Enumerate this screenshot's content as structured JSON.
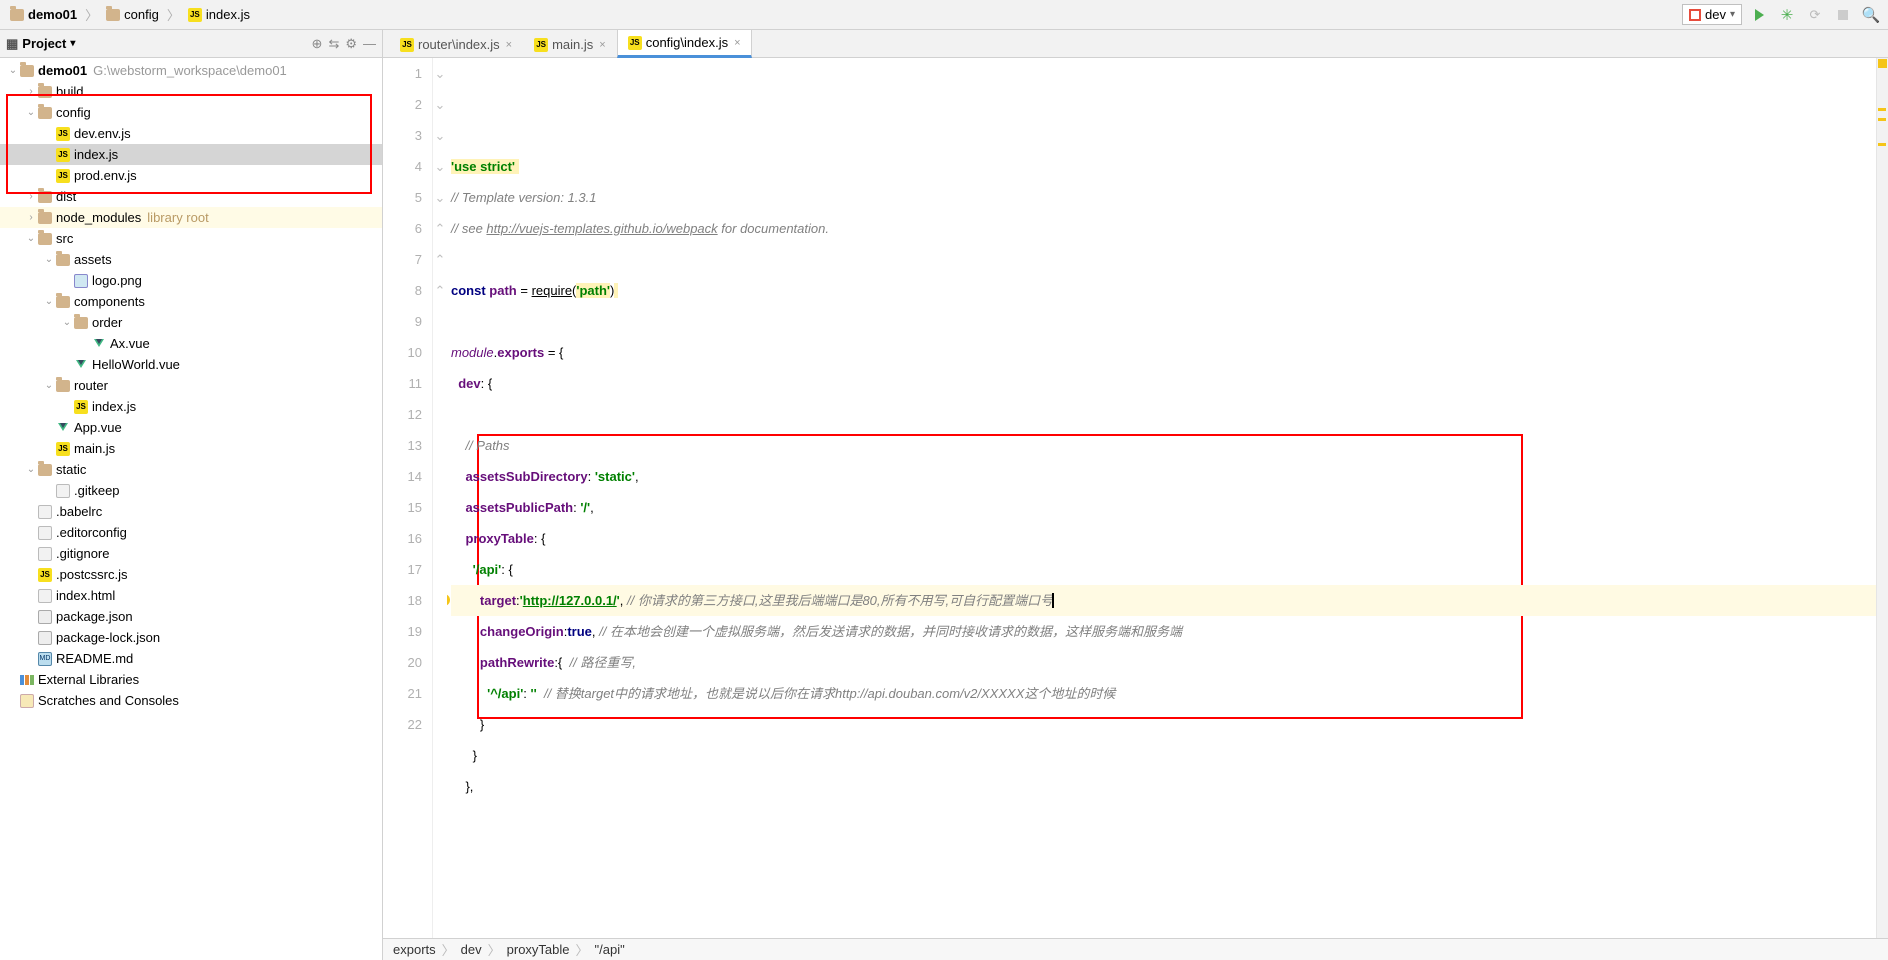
{
  "breadcrumbs": [
    {
      "label": "demo01",
      "icon": "folder",
      "bold": true
    },
    {
      "label": "config",
      "icon": "folder"
    },
    {
      "label": "index.js",
      "icon": "js"
    }
  ],
  "run_config": "dev",
  "project_panel": {
    "title": "Project"
  },
  "tree": [
    {
      "d": 0,
      "tw": "v",
      "ico": "folder",
      "lbl": "demo01",
      "hint": "G:\\webstorm_workspace\\demo01",
      "bold": true
    },
    {
      "d": 1,
      "tw": ">",
      "ico": "folder",
      "lbl": "build"
    },
    {
      "d": 1,
      "tw": "v",
      "ico": "folder",
      "lbl": "config"
    },
    {
      "d": 2,
      "tw": "",
      "ico": "js",
      "lbl": "dev.env.js"
    },
    {
      "d": 2,
      "tw": "",
      "ico": "js",
      "lbl": "index.js",
      "sel": true
    },
    {
      "d": 2,
      "tw": "",
      "ico": "js",
      "lbl": "prod.env.js"
    },
    {
      "d": 1,
      "tw": ">",
      "ico": "folder",
      "lbl": "dist"
    },
    {
      "d": 1,
      "tw": ">",
      "ico": "folder",
      "lbl": "node_modules",
      "libhint": "library root",
      "lib": true
    },
    {
      "d": 1,
      "tw": "v",
      "ico": "folder",
      "lbl": "src"
    },
    {
      "d": 2,
      "tw": "v",
      "ico": "folder",
      "lbl": "assets"
    },
    {
      "d": 3,
      "tw": "",
      "ico": "img",
      "lbl": "logo.png"
    },
    {
      "d": 2,
      "tw": "v",
      "ico": "folder",
      "lbl": "components"
    },
    {
      "d": 3,
      "tw": "v",
      "ico": "folder",
      "lbl": "order"
    },
    {
      "d": 4,
      "tw": "",
      "ico": "vue",
      "lbl": "Ax.vue"
    },
    {
      "d": 3,
      "tw": "",
      "ico": "vue",
      "lbl": "HelloWorld.vue"
    },
    {
      "d": 2,
      "tw": "v",
      "ico": "folder",
      "lbl": "router"
    },
    {
      "d": 3,
      "tw": "",
      "ico": "js",
      "lbl": "index.js"
    },
    {
      "d": 2,
      "tw": "",
      "ico": "vue",
      "lbl": "App.vue"
    },
    {
      "d": 2,
      "tw": "",
      "ico": "js",
      "lbl": "main.js"
    },
    {
      "d": 1,
      "tw": "v",
      "ico": "folder",
      "lbl": "static"
    },
    {
      "d": 2,
      "tw": "",
      "ico": "txt",
      "lbl": ".gitkeep"
    },
    {
      "d": 1,
      "tw": "",
      "ico": "txt",
      "lbl": ".babelrc"
    },
    {
      "d": 1,
      "tw": "",
      "ico": "txt",
      "lbl": ".editorconfig"
    },
    {
      "d": 1,
      "tw": "",
      "ico": "txt",
      "lbl": ".gitignore"
    },
    {
      "d": 1,
      "tw": "",
      "ico": "js",
      "lbl": ".postcssrc.js"
    },
    {
      "d": 1,
      "tw": "",
      "ico": "txt",
      "lbl": "index.html"
    },
    {
      "d": 1,
      "tw": "",
      "ico": "json",
      "lbl": "package.json"
    },
    {
      "d": 1,
      "tw": "",
      "ico": "json",
      "lbl": "package-lock.json"
    },
    {
      "d": 1,
      "tw": "",
      "ico": "md",
      "lbl": "README.md"
    },
    {
      "d": 0,
      "tw": "",
      "ico": "lib",
      "lbl": "External Libraries"
    },
    {
      "d": 0,
      "tw": "",
      "ico": "scratch",
      "lbl": "Scratches and Consoles"
    }
  ],
  "tabs": [
    {
      "label": "router\\index.js",
      "icon": "js",
      "active": false
    },
    {
      "label": "main.js",
      "icon": "js",
      "active": false
    },
    {
      "label": "config\\index.js",
      "icon": "js",
      "active": true
    }
  ],
  "code": {
    "lines": [
      {
        "n": 1,
        "fold": "",
        "html": "<span class='tok-str tok-hi'>'use strict'</span><span class='tok-hi'> </span>"
      },
      {
        "n": 2,
        "fold": "",
        "html": "<span class='tok-com'>// Template version: 1.3.1</span>"
      },
      {
        "n": 3,
        "fold": "",
        "html": "<span class='tok-com'>// see </span><span class='tok-link'>http://vuejs-templates.github.io/webpack</span><span class='tok-com'> for documentation.</span>"
      },
      {
        "n": 4,
        "fold": "",
        "html": ""
      },
      {
        "n": 5,
        "fold": "",
        "html": "<span class='tok-kw'>const</span> <span class='tok-prop'>path</span> = <span style='text-decoration:underline'>require</span>(<span class='tok-str tok-hi'>'path'</span>)<span class='tok-hi'> </span>"
      },
      {
        "n": 6,
        "fold": "",
        "html": ""
      },
      {
        "n": 7,
        "fold": "v",
        "html": "<span class='tok-mod'>module</span>.<span class='tok-prop'>exports</span> = {"
      },
      {
        "n": 8,
        "fold": "v",
        "html": "  <span class='tok-prop'>dev</span>: {"
      },
      {
        "n": 9,
        "fold": "",
        "html": ""
      },
      {
        "n": 10,
        "fold": "",
        "html": "    <span class='tok-com'>// Paths</span>"
      },
      {
        "n": 11,
        "fold": "",
        "html": "    <span class='tok-prop'>assetsSubDirectory</span>: <span class='tok-str'>'static'</span>,"
      },
      {
        "n": 12,
        "fold": "",
        "html": "    <span class='tok-prop'>assetsPublicPath</span>: <span class='tok-str'>'/'</span>,"
      },
      {
        "n": 13,
        "fold": "v",
        "html": "    <span class='tok-prop'>proxyTable</span>: {"
      },
      {
        "n": 14,
        "fold": "v",
        "html": "      <span class='tok-str'>'/api'</span>: {"
      },
      {
        "n": 15,
        "fold": "",
        "hl": true,
        "bulb": true,
        "html": "        <span class='tok-prop'>target</span>:<span class='tok-str'>'</span><span class='tok-url'>http://127.0.0.1/</span><span class='tok-str'>'</span>, <span class='tok-com'>// 你请求的第三方接口,这里我后端端口是80,所有不用写,可自行配置端口号</span><span class='caret-mark'></span>"
      },
      {
        "n": 16,
        "fold": "",
        "html": "        <span class='tok-prop'>changeOrigin</span>:<span class='tok-kw'>true</span>, <span class='tok-com'>// 在本地会创建一个虚拟服务端，然后发送请求的数据，并同时接收请求的数据，这样服务端和服务端</span>"
      },
      {
        "n": 17,
        "fold": "v",
        "html": "        <span class='tok-prop'>pathRewrite</span>:{  <span class='tok-com'>// 路径重写,</span>"
      },
      {
        "n": 18,
        "fold": "",
        "html": "          <span class='tok-str'>'^/api'</span>: <span class='tok-str'>''</span>  <span class='tok-com'>// 替换target中的请求地址，也就是说以后你在请求http://api.douban.com/v2/XXXXX这个地址的时候</span>"
      },
      {
        "n": 19,
        "fold": "^",
        "html": "        }"
      },
      {
        "n": 20,
        "fold": "^",
        "html": "      }"
      },
      {
        "n": 21,
        "fold": "^",
        "html": "    },"
      },
      {
        "n": 22,
        "fold": "",
        "html": ""
      }
    ]
  },
  "status_crumbs": [
    "exports",
    "dev",
    "proxyTable",
    "\"/api\""
  ]
}
